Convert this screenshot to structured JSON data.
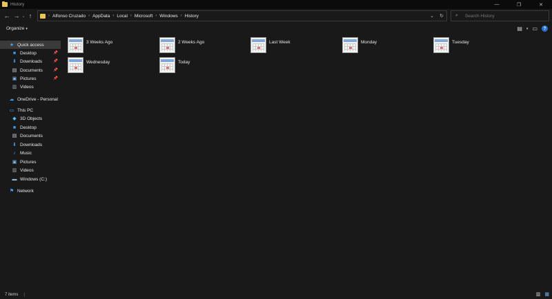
{
  "window": {
    "title": "History"
  },
  "window_controls": {
    "minimize": "—",
    "maximize": "❐",
    "close": "✕"
  },
  "nav": {
    "back": "←",
    "forward": "→",
    "recent": "⌄",
    "up": "↑"
  },
  "address": {
    "breadcrumbs": [
      "Alfonso Cruzado",
      "AppData",
      "Local",
      "Microsoft",
      "Windows",
      "History"
    ],
    "separator": "›",
    "dropdown": "⌄",
    "refresh": "↻"
  },
  "search": {
    "placeholder": "Search History",
    "icon": "⌕"
  },
  "commands": {
    "organize": "Organize",
    "organize_caret": "▾",
    "view_caret": "▾"
  },
  "sidebar": {
    "quick_access": "Quick access",
    "qa_items": [
      {
        "label": "Desktop",
        "pinned": true
      },
      {
        "label": "Downloads",
        "pinned": true
      },
      {
        "label": "Documents",
        "pinned": true
      },
      {
        "label": "Pictures",
        "pinned": true
      },
      {
        "label": "Videos",
        "pinned": false
      }
    ],
    "onedrive": "OneDrive - Personal",
    "this_pc": "This PC",
    "pc_items": [
      "3D Objects",
      "Desktop",
      "Documents",
      "Downloads",
      "Music",
      "Pictures",
      "Videos",
      "Windows (C:)"
    ],
    "network": "Network",
    "pin_glyph": "📌"
  },
  "folders": [
    {
      "label": "3 Weeks Ago"
    },
    {
      "label": "2 Weeks Ago"
    },
    {
      "label": "Last Week"
    },
    {
      "label": "Monday"
    },
    {
      "label": "Tuesday"
    },
    {
      "label": "Wednesday"
    },
    {
      "label": "Today"
    }
  ],
  "status": {
    "item_count": "7 items",
    "separator": "|"
  },
  "colors": {
    "background": "#191919",
    "selected": "#3a3a3a",
    "accent": "#2a72d6",
    "folder": "#e8c45a"
  },
  "icons": {
    "star": "star-icon",
    "folder": "folder-icon",
    "download": "download-arrow-icon",
    "cloud": "cloud-icon",
    "pc": "computer-icon",
    "network": "network-icon",
    "music": "music-note-icon",
    "drive": "drive-icon"
  }
}
